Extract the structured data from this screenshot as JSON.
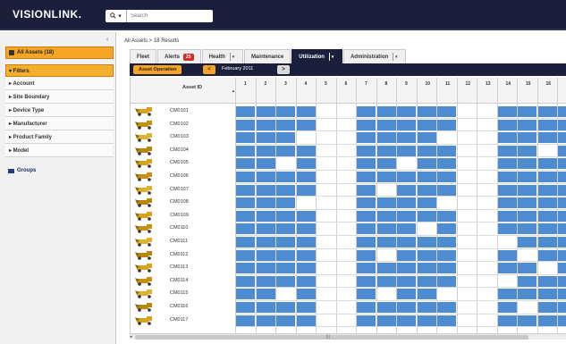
{
  "header": {
    "logo": "VISIONLINK.",
    "logo_sub": "",
    "search_placeholder": "Search"
  },
  "sidebar": {
    "all_assets_label": "All Assets (18)",
    "filters_label": "▾ Filters",
    "filters": [
      "▸ Account",
      "▸ Site Boundary",
      "▸ Device Type",
      "▸ Manufacturer",
      "▸ Product Family",
      "▸ Model"
    ],
    "groups_label": "Groups"
  },
  "breadcrumb": "All Assets > 18 Results",
  "tabs": [
    {
      "label": "Fleet",
      "dropdown": false,
      "active": false
    },
    {
      "label": "Alerts",
      "dropdown": false,
      "active": false,
      "badge": "25"
    },
    {
      "label": "Health",
      "dropdown": true,
      "active": false
    },
    {
      "label": "Maintenance",
      "dropdown": false,
      "active": false
    },
    {
      "label": "Utilization",
      "dropdown": true,
      "active": true
    },
    {
      "label": "Administration",
      "dropdown": true,
      "active": false
    }
  ],
  "subbar": {
    "asset_operation_label": "Asset Operation",
    "month": "February 2011",
    "prev_label": "<",
    "next_label": ">"
  },
  "grid": {
    "id_header": "Asset ID",
    "days": [
      "1",
      "2",
      "3",
      "4",
      "5",
      "6",
      "7",
      "8",
      "9",
      "10",
      "11",
      "12",
      "13",
      "14",
      "15",
      "16",
      "17"
    ],
    "accent_color": "#4e8bd0",
    "rows": [
      {
        "id": "CM0101",
        "on": [
          1,
          1,
          1,
          1,
          0,
          0,
          1,
          1,
          1,
          1,
          1,
          0,
          0,
          1,
          1,
          1,
          1
        ]
      },
      {
        "id": "CM0102",
        "on": [
          1,
          1,
          1,
          1,
          0,
          0,
          1,
          1,
          1,
          1,
          1,
          0,
          0,
          1,
          1,
          1,
          1
        ]
      },
      {
        "id": "CM0103",
        "on": [
          1,
          1,
          1,
          0,
          0,
          0,
          1,
          1,
          1,
          1,
          0,
          0,
          0,
          1,
          1,
          1,
          1
        ]
      },
      {
        "id": "CM0104",
        "on": [
          1,
          1,
          1,
          1,
          0,
          0,
          1,
          1,
          1,
          1,
          1,
          0,
          0,
          1,
          1,
          0,
          1
        ]
      },
      {
        "id": "CM0105",
        "on": [
          1,
          1,
          0,
          1,
          0,
          0,
          1,
          1,
          0,
          1,
          1,
          0,
          0,
          1,
          1,
          1,
          1
        ]
      },
      {
        "id": "CM0106",
        "on": [
          1,
          1,
          1,
          1,
          0,
          0,
          1,
          1,
          1,
          1,
          1,
          0,
          0,
          1,
          1,
          1,
          1
        ]
      },
      {
        "id": "CM0107",
        "on": [
          1,
          1,
          1,
          1,
          0,
          0,
          1,
          0,
          1,
          1,
          1,
          0,
          0,
          1,
          1,
          1,
          1
        ]
      },
      {
        "id": "CM0108",
        "on": [
          1,
          1,
          1,
          0,
          0,
          0,
          1,
          1,
          1,
          1,
          0,
          0,
          0,
          1,
          1,
          1,
          1
        ]
      },
      {
        "id": "CM0109",
        "on": [
          1,
          1,
          1,
          1,
          0,
          0,
          1,
          1,
          1,
          1,
          1,
          0,
          0,
          1,
          1,
          1,
          1
        ]
      },
      {
        "id": "CM0110",
        "on": [
          1,
          1,
          1,
          1,
          0,
          0,
          1,
          1,
          1,
          0,
          1,
          0,
          0,
          1,
          1,
          1,
          1
        ]
      },
      {
        "id": "CM0111",
        "on": [
          1,
          1,
          1,
          1,
          0,
          0,
          1,
          1,
          1,
          1,
          1,
          0,
          0,
          0,
          1,
          1,
          1
        ]
      },
      {
        "id": "CM0112",
        "on": [
          1,
          1,
          1,
          1,
          0,
          0,
          1,
          0,
          1,
          1,
          1,
          0,
          0,
          1,
          0,
          1,
          1
        ]
      },
      {
        "id": "CM0113",
        "on": [
          1,
          1,
          1,
          1,
          0,
          0,
          1,
          1,
          1,
          1,
          1,
          0,
          0,
          1,
          1,
          0,
          1
        ]
      },
      {
        "id": "CM0114",
        "on": [
          1,
          1,
          1,
          1,
          0,
          0,
          1,
          1,
          1,
          1,
          1,
          0,
          0,
          0,
          1,
          1,
          1
        ]
      },
      {
        "id": "CM0115",
        "on": [
          1,
          1,
          0,
          1,
          0,
          0,
          1,
          0,
          1,
          1,
          0,
          0,
          0,
          1,
          1,
          1,
          1
        ]
      },
      {
        "id": "CM0116",
        "on": [
          1,
          1,
          1,
          1,
          0,
          0,
          1,
          1,
          1,
          1,
          1,
          0,
          0,
          1,
          0,
          1,
          1
        ]
      },
      {
        "id": "CM0117",
        "on": [
          1,
          1,
          1,
          1,
          0,
          0,
          1,
          1,
          1,
          1,
          1,
          0,
          0,
          1,
          1,
          1,
          1
        ]
      }
    ]
  }
}
